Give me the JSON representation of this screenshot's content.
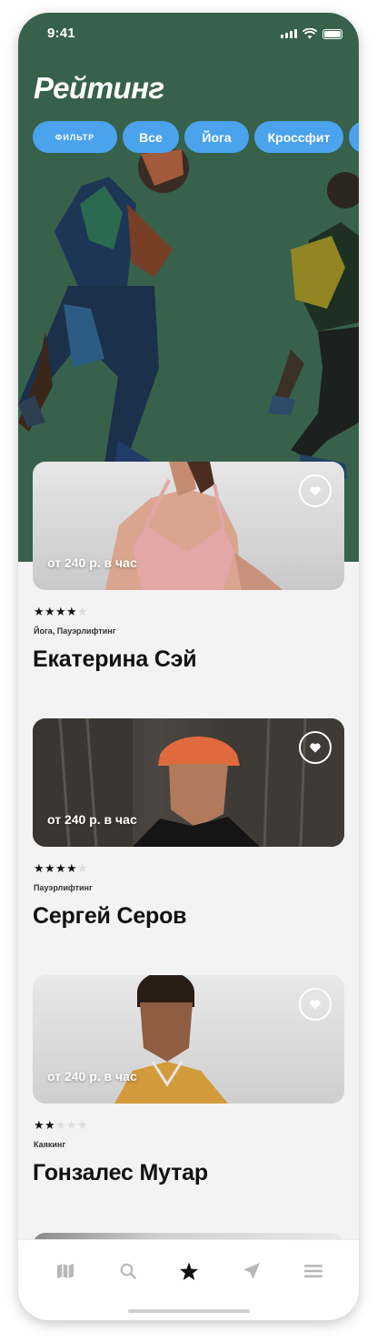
{
  "status_bar": {
    "time": "9:41"
  },
  "header": {
    "title": "Рейтинг"
  },
  "filters": {
    "filter_label": "Фильтр",
    "chips": [
      "Все",
      "Йога",
      "Кроссфит"
    ]
  },
  "trainers": [
    {
      "price": "от 240 р. в час",
      "rating": 4,
      "max_rating": 5,
      "tags": "Йога, Пауэрлифтинг",
      "name": "Екатерина Сэй"
    },
    {
      "price": "от 240 р. в час",
      "rating": 4,
      "max_rating": 5,
      "tags": "Пауэрлифтинг",
      "name": "Сергей Серов"
    },
    {
      "price": "от 240 р. в час",
      "rating": 2,
      "max_rating": 5,
      "tags": "Каякинг",
      "name": "Гонзалес Мутар"
    }
  ],
  "tab_bar": {
    "items": [
      "map-icon",
      "search-icon",
      "star-icon",
      "send-icon",
      "menu-icon"
    ],
    "active": "star-icon"
  },
  "colors": {
    "hero_bg": "#38614b",
    "chip_bg": "#4aa3ec",
    "tab_active": "#111111",
    "tab_inactive": "#b8b8b8"
  }
}
